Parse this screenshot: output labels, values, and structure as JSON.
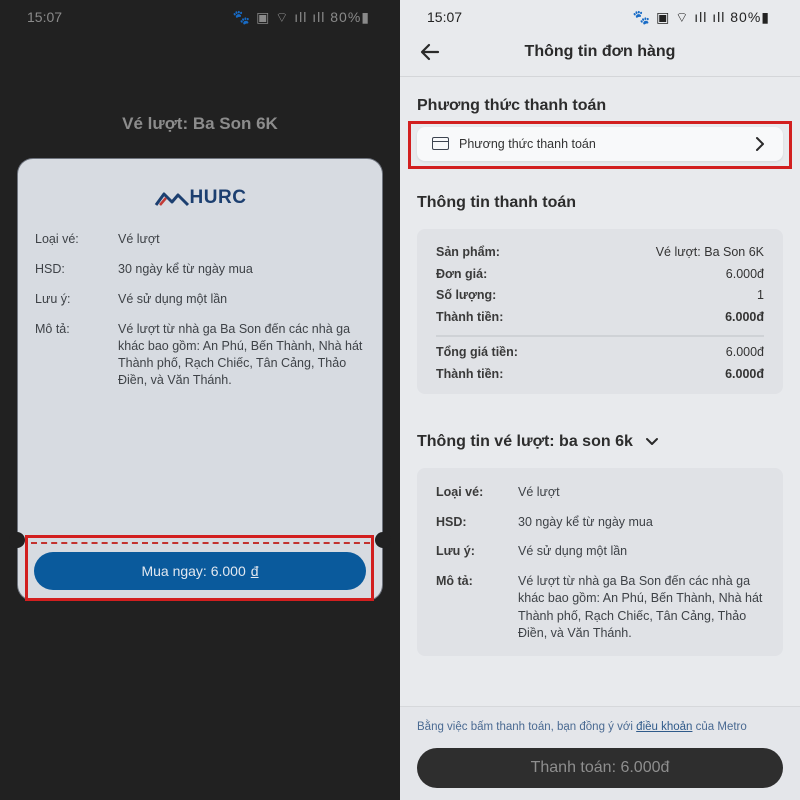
{
  "left": {
    "status": {
      "time": "15:07",
      "icons": "🐾 ▣ ⌔ ıll ıll 80%▮"
    },
    "title": "Vé lượt: Ba Son 6K",
    "logo_text": "HURC",
    "info": [
      {
        "k": "Loại vé:",
        "v": "Vé lượt"
      },
      {
        "k": "HSD:",
        "v": "30 ngày kể từ ngày mua"
      },
      {
        "k": "Lưu ý:",
        "v": "Vé sử dụng một lần"
      },
      {
        "k": "Mô tả:",
        "v": "Vé lượt từ nhà ga Ba Son đến các nhà ga khác bao gồm: An Phú, Bến Thành, Nhà hát Thành phố, Rạch Chiếc, Tân Cảng, Thảo Điền, và Văn Thánh."
      }
    ],
    "buy_button": {
      "label": "Mua ngay: 6.000",
      "currency": "đ"
    }
  },
  "right": {
    "status": {
      "time": "15:07",
      "icons": "🐾 ▣ ⌔ ıll ıll 80%▮"
    },
    "app_title": "Thông tin đơn hàng",
    "payment_method_section": "Phương thức thanh toán",
    "payment_method_label": "Phương thức thanh toán",
    "payment_info_section": "Thông tin thanh toán",
    "payment_rows": [
      {
        "k": "Sản phẩm:",
        "v": "Vé lượt: Ba Son 6K"
      },
      {
        "k": "Đơn giá:",
        "v": "6.000đ"
      },
      {
        "k": "Số lượng:",
        "v": "1"
      },
      {
        "k": "Thành tiền:",
        "v": "6.000đ"
      }
    ],
    "total_rows": [
      {
        "k": "Tổng giá tiền:",
        "v": "6.000đ"
      },
      {
        "k": "Thành tiền:",
        "v": "6.000đ"
      }
    ],
    "ticket_section": "Thông tin vé lượt: ba son 6k",
    "ticket_info": [
      {
        "k": "Loại vé:",
        "v": "Vé lượt"
      },
      {
        "k": "HSD:",
        "v": "30 ngày kể từ ngày mua"
      },
      {
        "k": "Lưu ý:",
        "v": "Vé sử dụng một lần"
      },
      {
        "k": "Mô tả:",
        "v": "Vé lượt từ nhà ga Ba Son đến các nhà ga khác bao gồm: An Phú, Bến Thành, Nhà hát Thành phố, Rạch Chiếc, Tân Cảng, Thảo Điền, và Văn Thánh."
      }
    ],
    "terms": {
      "prefix": "Bằng việc bấm thanh toán, bạn đồng ý với ",
      "link": "điều khoản",
      "suffix": " của Metro"
    },
    "pay_button": "Thanh toán: 6.000đ"
  },
  "colors": {
    "accent_blue": "#0a5a9c",
    "highlight_red": "#d21f1f"
  }
}
